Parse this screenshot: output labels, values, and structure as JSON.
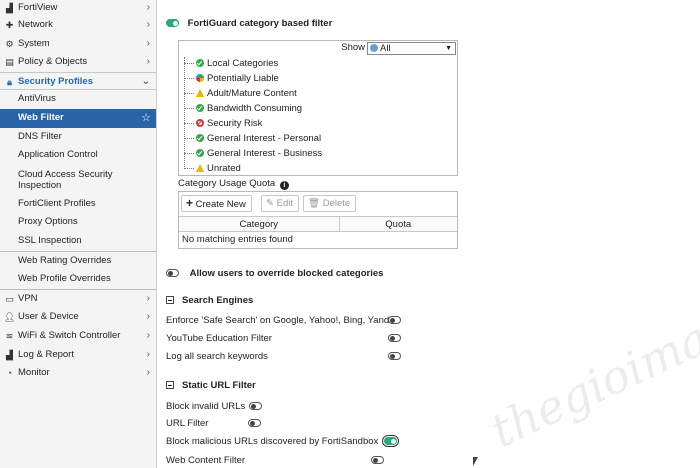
{
  "sidebar": {
    "top_items": [
      {
        "label": "FortiView",
        "icon": "chart-icon"
      },
      {
        "label": "Network",
        "icon": "network-icon"
      },
      {
        "label": "System",
        "icon": "gear-icon"
      },
      {
        "label": "Policy & Objects",
        "icon": "policy-icon"
      }
    ],
    "security_profiles": {
      "label": "Security Profiles",
      "icon": "lock-icon"
    },
    "sub_items": [
      "AntiVirus",
      "Web Filter",
      "DNS Filter",
      "Application Control",
      "Cloud Access Security Inspection",
      "FortiClient Profiles",
      "Proxy Options",
      "SSL Inspection"
    ],
    "override_items": [
      "Web Rating Overrides",
      "Web Profile Overrides"
    ],
    "bottom_items": [
      {
        "label": "VPN",
        "icon": "vpn-icon"
      },
      {
        "label": "User & Device",
        "icon": "user-icon"
      },
      {
        "label": "WiFi & Switch Controller",
        "icon": "wifi-icon"
      },
      {
        "label": "Log & Report",
        "icon": "chart-icon"
      },
      {
        "label": "Monitor",
        "icon": "monitor-icon"
      }
    ]
  },
  "main": {
    "fortiguard_label": "FortiGuard category based filter",
    "show_label": "Show",
    "show_value": "All",
    "categories": [
      {
        "label": "Local Categories",
        "status": "ok"
      },
      {
        "label": "Potentially Liable",
        "status": "mixed"
      },
      {
        "label": "Adult/Mature Content",
        "status": "warn"
      },
      {
        "label": "Bandwidth Consuming",
        "status": "ok"
      },
      {
        "label": "Security Risk",
        "status": "block"
      },
      {
        "label": "General Interest - Personal",
        "status": "ok"
      },
      {
        "label": "General Interest - Business",
        "status": "ok"
      },
      {
        "label": "Unrated",
        "status": "warn"
      }
    ],
    "quota_title": "Category Usage Quota",
    "create_new_label": "Create New",
    "edit_label": "Edit",
    "delete_label": "Delete",
    "col_category": "Category",
    "col_quota": "Quota",
    "empty_text": "No matching entries found",
    "override_label": "Allow users to override blocked categories",
    "search_engines_title": "Search Engines",
    "safe_search_label": "Enforce 'Safe Search' on Google, Yahoo!, Bing, Yandex",
    "youtube_label": "YouTube Education Filter",
    "log_search_label": "Log all search keywords",
    "static_url_title": "Static URL Filter",
    "block_invalid_label": "Block invalid URLs",
    "url_filter_label": "URL Filter",
    "block_malicious_label": "Block malicious URLs discovered by FortiSandbox",
    "web_content_label": "Web Content Filter"
  },
  "watermark": "thegioimang.vn",
  "colors": {
    "accent": "#2a64a8",
    "toggle_on": "#29a87b"
  }
}
